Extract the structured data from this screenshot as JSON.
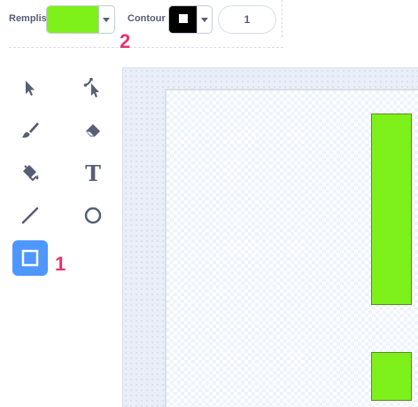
{
  "toolbar": {
    "fill_label": "Remplissage",
    "fill_color": "#7ef01a",
    "outline_label": "Contour",
    "outline_color": "#000000",
    "outline_width": "1"
  },
  "callouts": {
    "one": "1",
    "two": "2"
  },
  "tools": [
    {
      "name": "select",
      "icon": "select-arrow-icon"
    },
    {
      "name": "reshape",
      "icon": "reshape-arrow-icon"
    },
    {
      "name": "brush",
      "icon": "brush-icon"
    },
    {
      "name": "eraser",
      "icon": "eraser-icon"
    },
    {
      "name": "fill",
      "icon": "fill-bucket-icon"
    },
    {
      "name": "text",
      "icon": "text-icon",
      "glyph": "T"
    },
    {
      "name": "line",
      "icon": "line-icon"
    },
    {
      "name": "circle",
      "icon": "circle-icon"
    },
    {
      "name": "rectangle",
      "icon": "rectangle-icon",
      "active": true
    }
  ],
  "canvas": {
    "shape_color": "#7ef01a",
    "shape_outline": "#5b8a2b"
  },
  "colors": {
    "accent": "#4d97ff",
    "icon": "#575e75",
    "callout": "#e8336d"
  }
}
